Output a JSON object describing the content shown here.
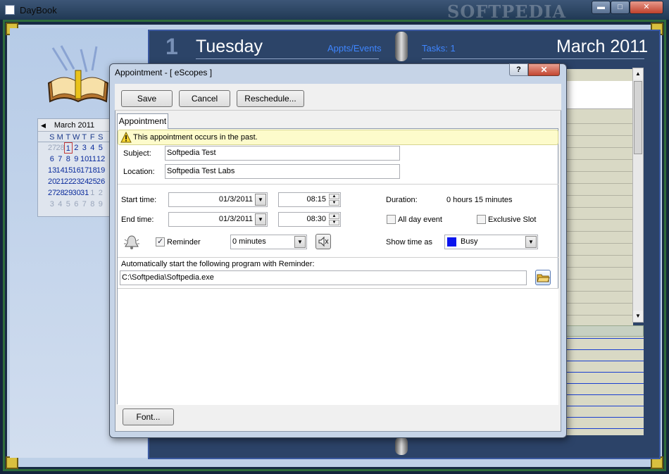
{
  "window": {
    "title": "DayBook",
    "watermark": "SOFTPEDIA",
    "min_icon": "minimize-icon",
    "max_icon": "maximize-icon",
    "close_icon": "close-icon"
  },
  "mini_calendar": {
    "month": "March 2011",
    "weekday_headers": [
      "S",
      "M",
      "T",
      "W",
      "T",
      "F",
      "S"
    ],
    "weeks": [
      [
        "27",
        "28",
        "1",
        "2",
        "3",
        "4",
        "5"
      ],
      [
        "6",
        "7",
        "8",
        "9",
        "10",
        "11",
        "12"
      ],
      [
        "13",
        "14",
        "15",
        "16",
        "17",
        "18",
        "19"
      ],
      [
        "20",
        "21",
        "22",
        "23",
        "24",
        "25",
        "26"
      ],
      [
        "27",
        "28",
        "29",
        "30",
        "31",
        "1",
        "2"
      ],
      [
        "3",
        "4",
        "5",
        "6",
        "7",
        "8",
        "9"
      ]
    ],
    "selected_day": "1"
  },
  "day_page": {
    "day_number": "1",
    "day_name": "Tuesday",
    "appts_link": "Appts/Events",
    "tasks_link": "Tasks: 1",
    "month_year": "March 2011"
  },
  "dialog": {
    "title": "Appointment  - [ eScopes  ]",
    "help_label": "?",
    "close_label": "✕",
    "save_label": "Save",
    "cancel_label": "Cancel",
    "reschedule_label": "Reschedule...",
    "tab_label": "Appointment",
    "warning_text": "This appointment occurs in the past.",
    "subject_label": "Subject:",
    "subject_value": "Softpedia Test",
    "location_label": "Location:",
    "location_value": "Softpedia Test Labs",
    "start_label": "Start time:",
    "start_date": "01/3/2011",
    "start_time": "08:15",
    "end_label": "End time:",
    "end_date": "01/3/2011",
    "end_time": "08:30",
    "duration_label": "Duration:",
    "duration_value": "0 hours 15 minutes",
    "all_day_label": "All day event",
    "all_day_checked": false,
    "exclusive_label": "Exclusive Slot",
    "exclusive_checked": false,
    "reminder_label": "Reminder",
    "reminder_checked": true,
    "reminder_value": "0 minutes",
    "show_time_label": "Show time as",
    "show_time_value": "Busy",
    "busy_color": "#0b15ee",
    "program_label": "Automatically start the following program with Reminder:",
    "program_value": "C:\\Softpedia\\Softpedia.exe",
    "font_label": "Font..."
  }
}
